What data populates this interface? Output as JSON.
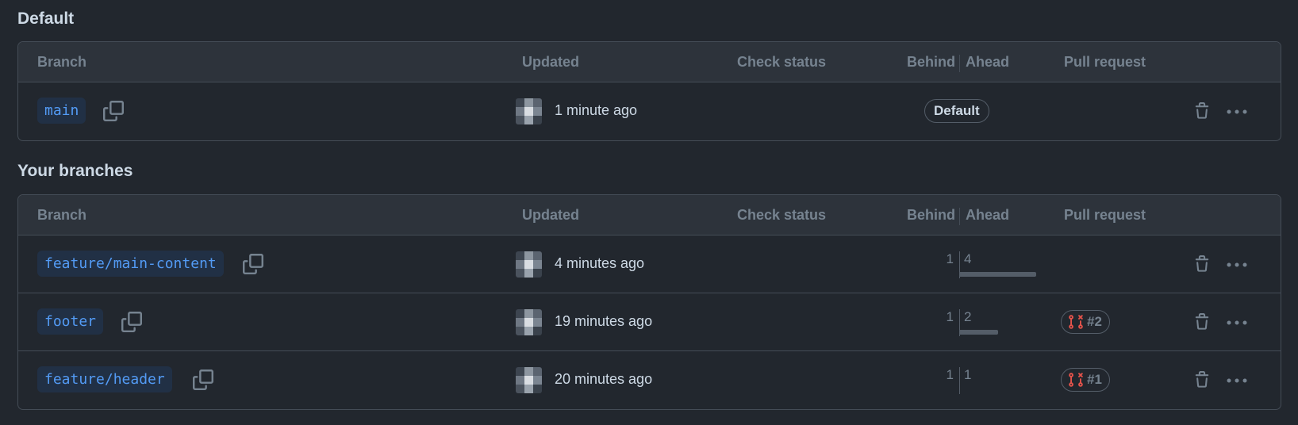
{
  "sections": {
    "default": {
      "title": "Default",
      "headers": {
        "branch": "Branch",
        "updated": "Updated",
        "check_status": "Check status",
        "behind": "Behind",
        "ahead": "Ahead",
        "pull_request": "Pull request"
      },
      "rows": [
        {
          "branch": "main",
          "updated": "1 minute ago",
          "badge": "Default"
        }
      ]
    },
    "yours": {
      "title": "Your branches",
      "headers": {
        "branch": "Branch",
        "updated": "Updated",
        "check_status": "Check status",
        "behind": "Behind",
        "ahead": "Ahead",
        "pull_request": "Pull request"
      },
      "rows": [
        {
          "branch": "feature/main-content",
          "updated": "4 minutes ago",
          "behind": "1",
          "ahead": "4",
          "pr": ""
        },
        {
          "branch": "footer",
          "updated": "19 minutes ago",
          "behind": "1",
          "ahead": "2",
          "pr": "#2"
        },
        {
          "branch": "feature/header",
          "updated": "20 minutes ago",
          "behind": "1",
          "ahead": "1",
          "pr": "#1"
        }
      ]
    }
  },
  "icons": {
    "copy": "copy-icon",
    "trash": "trash-icon",
    "more": "kebab-horizontal-icon",
    "pr_closed": "git-pull-request-closed-icon"
  },
  "colors": {
    "background": "#22272e",
    "header_bg": "#2d333b",
    "border": "#444c56",
    "branch_text": "#539bf5",
    "branch_bg": "#213045",
    "pr_closed": "#e5534b"
  }
}
